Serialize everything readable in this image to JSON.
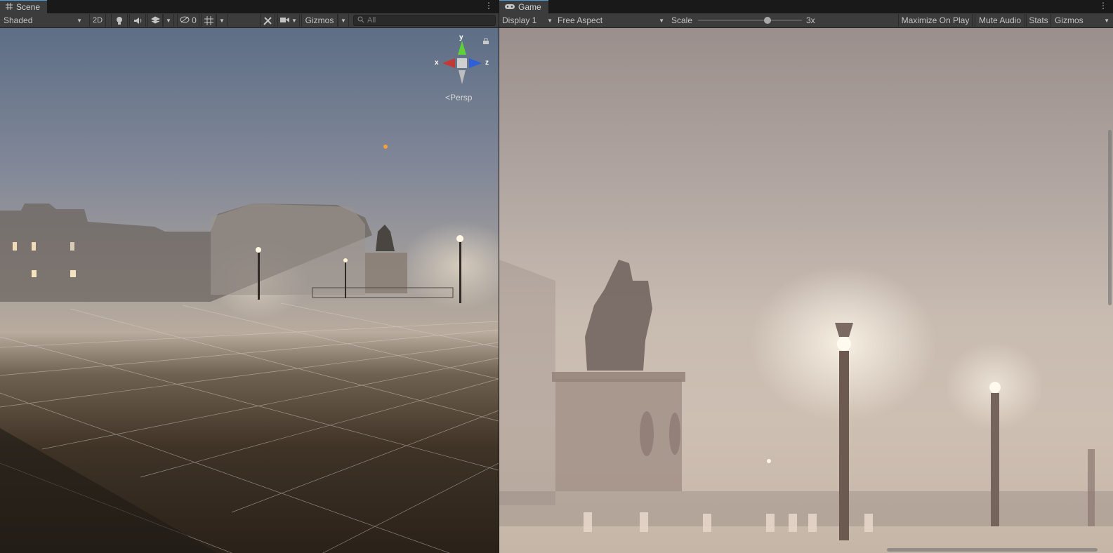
{
  "scene": {
    "tab_label": "Scene",
    "shading_mode": "Shaded",
    "mode_2d_label": "2D",
    "hidden_count": "0",
    "gizmos_label": "Gizmos",
    "search_placeholder": "All",
    "gizmo_axes": {
      "x": "x",
      "y": "y",
      "z": "z"
    },
    "projection_label": "Persp"
  },
  "game": {
    "tab_label": "Game",
    "display": "Display 1",
    "aspect": "Free Aspect",
    "scale_label": "Scale",
    "scale_value": "3x",
    "scale_slider_fraction": 0.67,
    "maximize_label": "Maximize On Play",
    "mute_label": "Mute Audio",
    "stats_label": "Stats",
    "gizmos_label": "Gizmos"
  },
  "colors": {
    "accent": "#4b9cd6",
    "panel_bg": "#282828",
    "toolbar_bg": "#3c3c3c",
    "axis_x": "#c23a34",
    "axis_y": "#5fcf3a",
    "axis_z": "#2f5fd8"
  },
  "icons": [
    "grid-icon",
    "gamepad-icon",
    "kebab-menu-icon",
    "lightbulb-icon",
    "speaker-icon",
    "effects-icon",
    "visibility-icon",
    "grid-snap-icon",
    "tools-icon",
    "camera-icon",
    "search-icon",
    "lock-icon"
  ]
}
